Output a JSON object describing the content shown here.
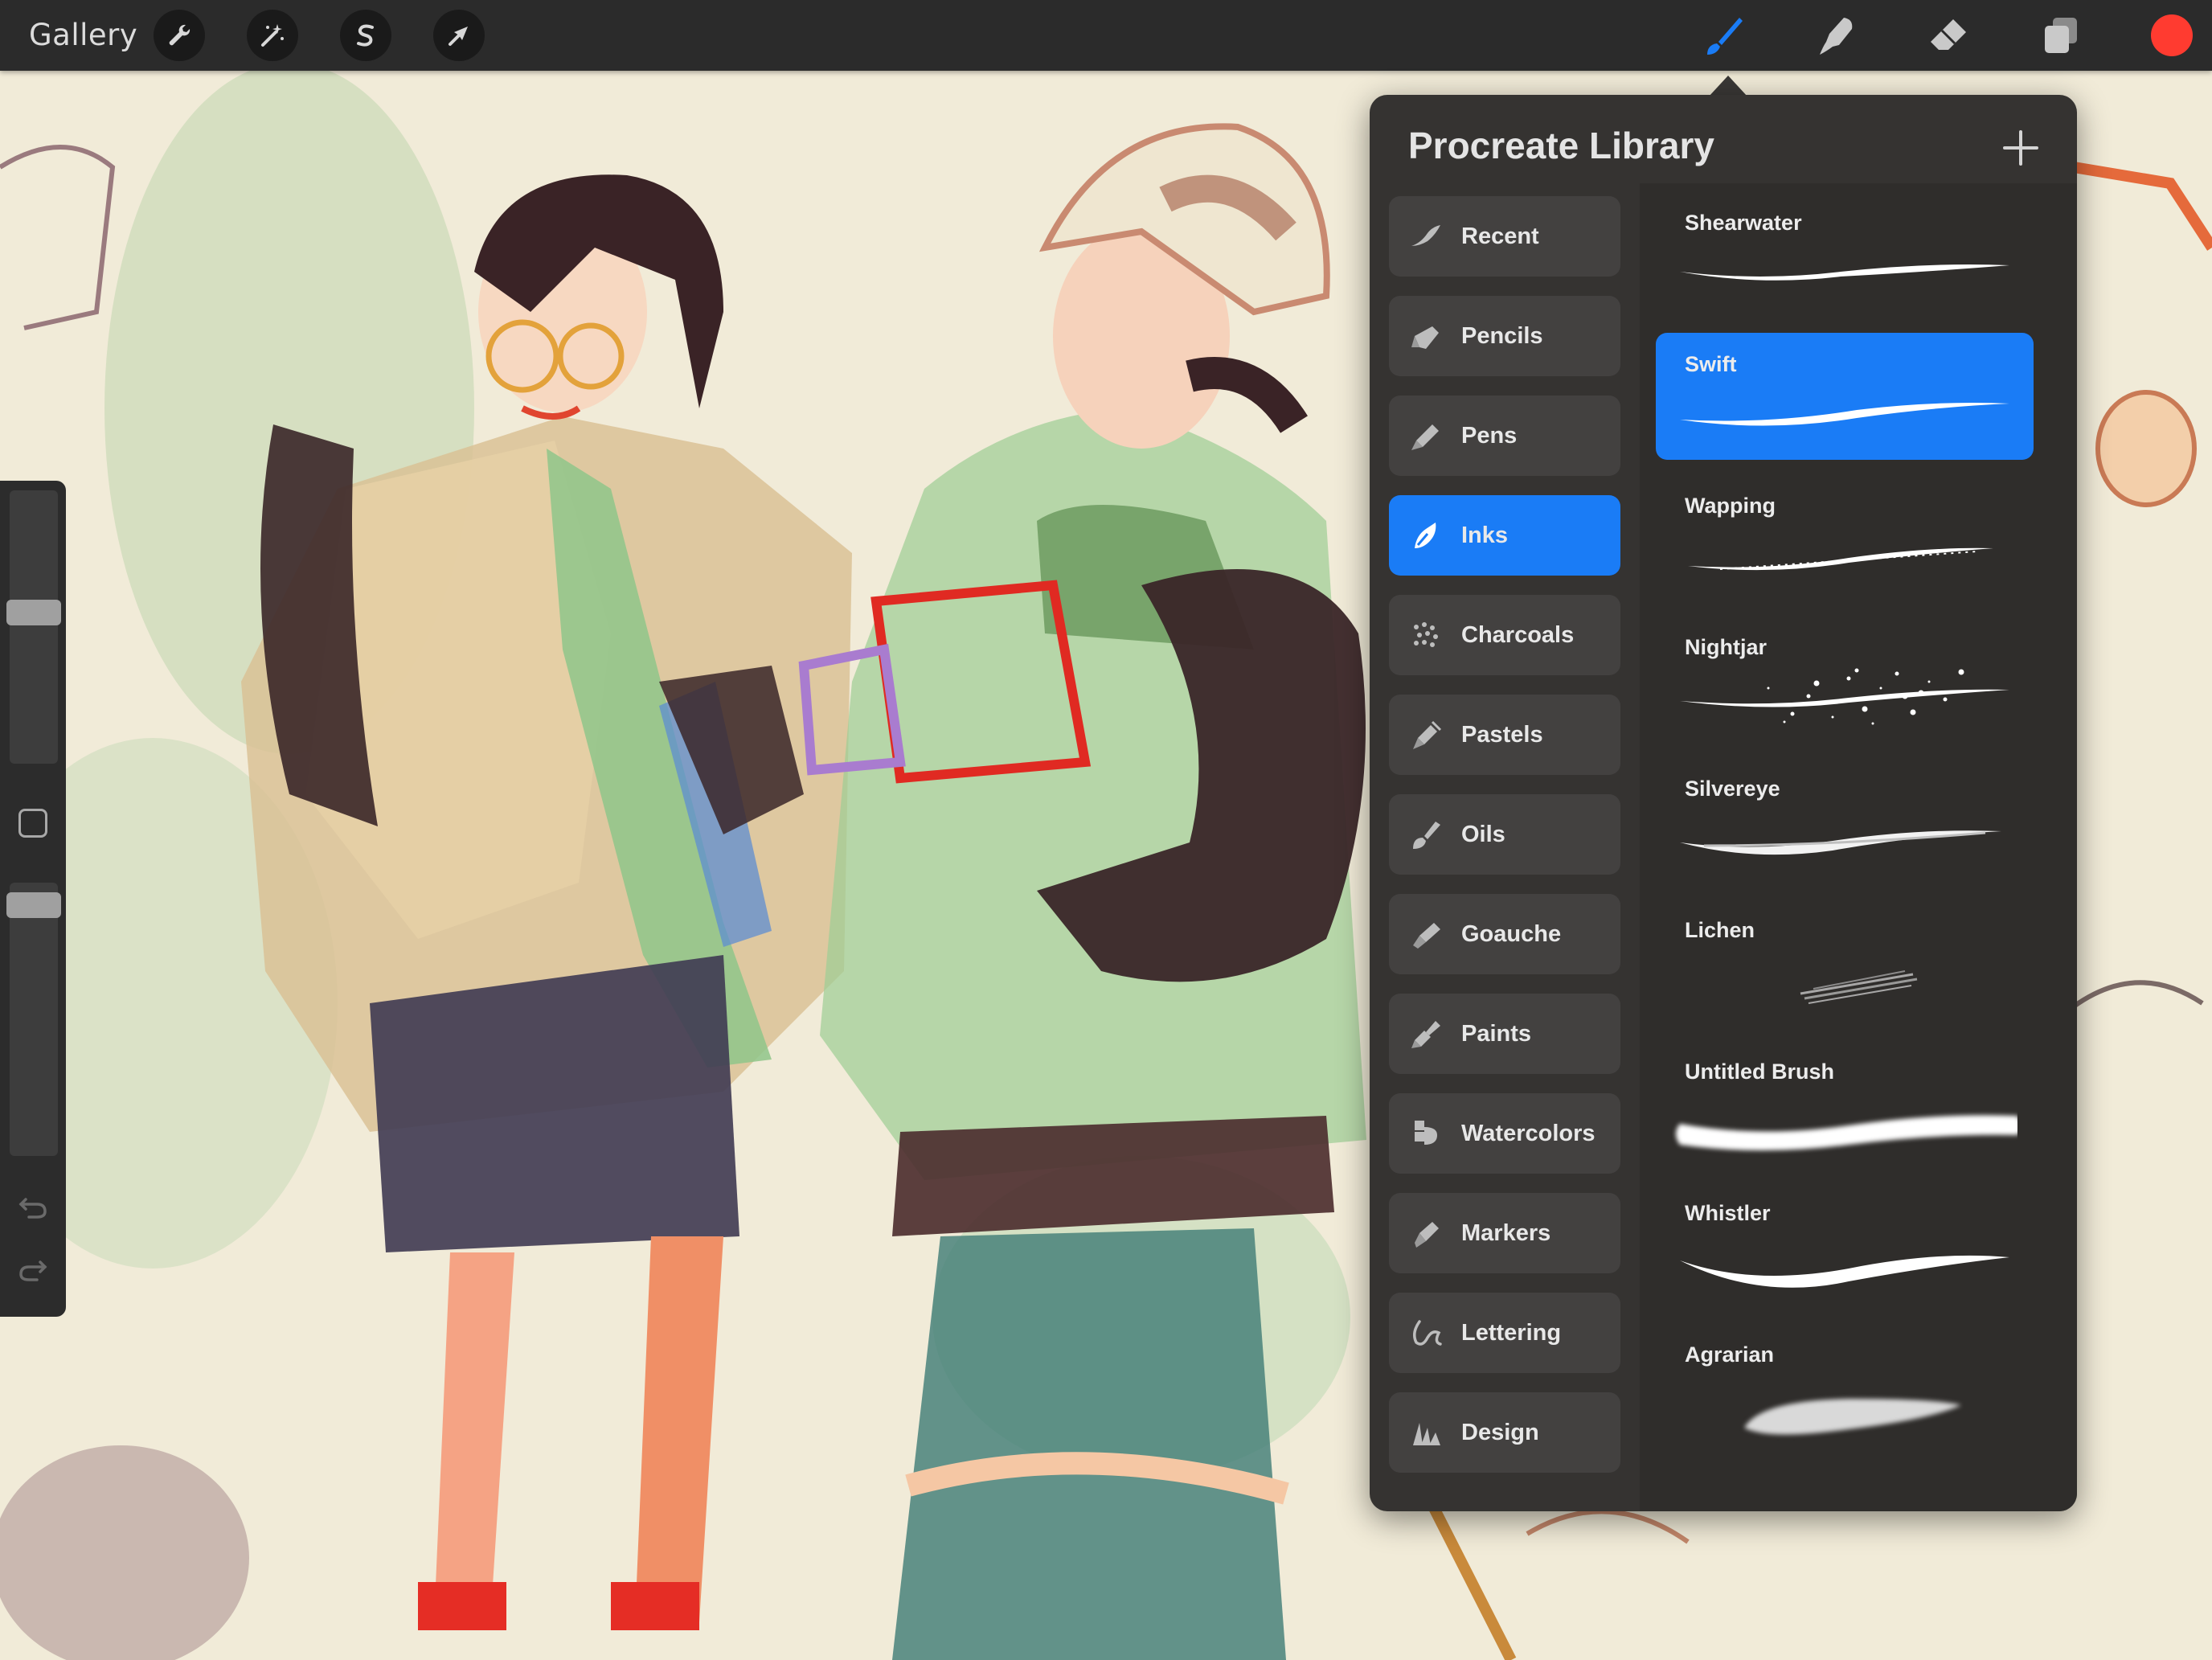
{
  "toolbar": {
    "gallery_label": "Gallery",
    "left_tools": [
      {
        "name": "actions",
        "icon": "wrench-icon"
      },
      {
        "name": "adjustments",
        "icon": "magic-wand-icon"
      },
      {
        "name": "selection",
        "icon": "selection-s-icon"
      },
      {
        "name": "transform",
        "icon": "arrow-cursor-icon"
      }
    ],
    "right_tools": [
      {
        "name": "brush",
        "icon": "brush-icon",
        "active": true
      },
      {
        "name": "smudge",
        "icon": "smudge-finger-icon"
      },
      {
        "name": "eraser",
        "icon": "eraser-icon"
      },
      {
        "name": "layers",
        "icon": "layers-icon"
      }
    ],
    "color": "#ff3b30",
    "active_accent": "#1a7cf6"
  },
  "sidebar": {
    "brush_size_level": 0.44,
    "opacity_level": 0.96,
    "icons": [
      "modify-square-icon",
      "undo-icon",
      "redo-icon"
    ]
  },
  "library": {
    "title": "Procreate Library",
    "add_icon": "plus-icon",
    "sets": [
      {
        "label": "Recent",
        "icon": "recent-stroke-icon",
        "active": false
      },
      {
        "label": "Pencils",
        "icon": "pencil-icon",
        "active": false
      },
      {
        "label": "Pens",
        "icon": "pen-icon",
        "active": false
      },
      {
        "label": "Inks",
        "icon": "ink-nib-icon",
        "active": true
      },
      {
        "label": "Charcoals",
        "icon": "charcoal-dots-icon",
        "active": false
      },
      {
        "label": "Pastels",
        "icon": "pastel-icon",
        "active": false
      },
      {
        "label": "Oils",
        "icon": "oil-brush-icon",
        "active": false
      },
      {
        "label": "Goauche",
        "icon": "gouache-icon",
        "active": false
      },
      {
        "label": "Paints",
        "icon": "paint-brush-icon",
        "active": false
      },
      {
        "label": "Watercolors",
        "icon": "watercolor-icon",
        "active": false
      },
      {
        "label": "Markers",
        "icon": "marker-icon",
        "active": false
      },
      {
        "label": "Lettering",
        "icon": "lettering-icon",
        "active": false
      },
      {
        "label": "Design",
        "icon": "design-icon",
        "active": false
      }
    ],
    "brushes": [
      {
        "label": "Shearwater",
        "style": "thin",
        "active": false
      },
      {
        "label": "Swift",
        "style": "taper",
        "active": true
      },
      {
        "label": "Wapping",
        "style": "rough",
        "active": false
      },
      {
        "label": "Nightjar",
        "style": "splatter",
        "active": false
      },
      {
        "label": "Silvereye",
        "style": "dry",
        "active": false
      },
      {
        "label": "Lichen",
        "style": "texture",
        "active": false
      },
      {
        "label": "Untitled Brush",
        "style": "soft",
        "active": false
      },
      {
        "label": "Whistler",
        "style": "bold",
        "active": false
      },
      {
        "label": "Agrarian",
        "style": "blob",
        "active": false
      }
    ]
  }
}
